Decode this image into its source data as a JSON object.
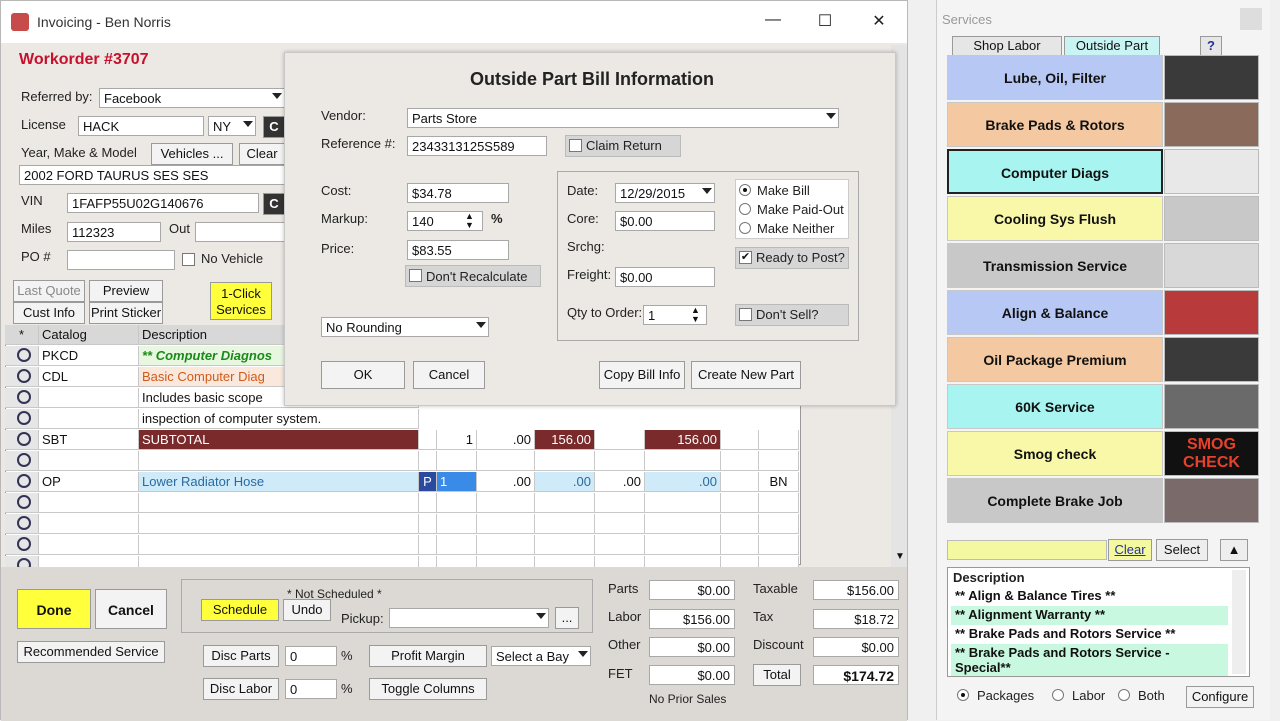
{
  "window": {
    "title": "Invoicing - Ben Norris",
    "minimize": "—",
    "maximize": "☐",
    "close": "✕"
  },
  "workorder": {
    "title": "Workorder #3707"
  },
  "left": {
    "referred_label": "Referred by:",
    "referred_value": "Facebook",
    "license_label": "License",
    "license_value": "HACK",
    "state_value": "NY",
    "ymm_label": "Year, Make & Model",
    "vehicles_btn": "Vehicles ...",
    "clear_btn": "Clear",
    "vehicle_value": "2002 FORD TAURUS SES SES",
    "vin_label": "VIN",
    "vin_value": "1FAFP55U02G140676",
    "miles_label": "Miles",
    "miles_value": "112323",
    "out_label": "Out",
    "po_label": "PO #",
    "no_vehicle": "No Vehicle",
    "last_quote": "Last Quote",
    "preview": "Preview",
    "cust_info": "Cust Info",
    "print_sticker": "Print Sticker",
    "one_click": "1-Click Services",
    "c_btn": "C"
  },
  "grid": {
    "headers": [
      "*",
      "Catalog",
      "Description"
    ],
    "rows": [
      {
        "catalog": "PKCD",
        "desc": "** Computer Diagnos"
      },
      {
        "catalog": "CDL",
        "desc": "Basic Computer Diag"
      },
      {
        "catalog": "",
        "desc": "Includes basic scope"
      },
      {
        "catalog": "",
        "desc": "inspection of computer system."
      },
      {
        "catalog": "SBT",
        "desc": "SUBTOTAL",
        "qty": "1",
        "c1": ".00",
        "c2": "156.00",
        "c4": "156.00"
      },
      {
        "catalog": "",
        "desc": ""
      },
      {
        "catalog": "OP",
        "desc": "Lower Radiator Hose",
        "flag": "P",
        "qty": "1",
        "c1": ".00",
        "c2": ".00",
        "c3": ".00",
        "c4": ".00",
        "tech": "BN"
      }
    ]
  },
  "bottom": {
    "done": "Done",
    "cancel": "Cancel",
    "recommended": "Recommended Service",
    "not_scheduled": "* Not Scheduled *",
    "schedule": "Schedule",
    "undo": "Undo",
    "pickup_label": "Pickup:",
    "ellipsis": "...",
    "disc_parts": "Disc Parts",
    "disc_parts_val": "0",
    "disc_labor": "Disc Labor",
    "disc_labor_val": "0",
    "pct": "%",
    "profit_margin": "Profit Margin",
    "toggle_columns": "Toggle Columns",
    "select_bay": "Select a Bay",
    "parts_label": "Parts",
    "parts_val": "$0.00",
    "labor_label": "Labor",
    "labor_val": "$156.00",
    "other_label": "Other",
    "other_val": "$0.00",
    "fet_label": "FET",
    "fet_val": "$0.00",
    "no_prior": "No Prior Sales",
    "taxable_label": "Taxable",
    "taxable_val": "$156.00",
    "tax_label": "Tax",
    "tax_val": "$18.72",
    "discount_label": "Discount",
    "discount_val": "$0.00",
    "total_btn": "Total",
    "total_val": "$174.72"
  },
  "dialog": {
    "title": "Outside Part Bill Information",
    "vendor_label": "Vendor:",
    "vendor_value": "Parts Store",
    "ref_label": "Reference #:",
    "ref_value": "2343313125S589",
    "claim_return": "Claim Return",
    "cost_label": "Cost:",
    "cost_value": "$34.78",
    "markup_label": "Markup:",
    "markup_value": "140",
    "markup_unit": "%",
    "price_label": "Price:",
    "price_value": "$83.55",
    "dont_recalc": "Don't Recalculate",
    "rounding_value": "No Rounding",
    "date_label": "Date:",
    "date_value": "12/29/2015",
    "core_label": "Core:",
    "core_value": "$0.00",
    "srchg_label": "Srchg:",
    "freight_label": "Freight:",
    "freight_value": "$0.00",
    "qty_label": "Qty to Order:",
    "qty_value": "1",
    "make_bill": "Make Bill",
    "make_paid_out": "Make Paid-Out",
    "make_neither": "Make Neither",
    "ready_to_post": "Ready to Post?",
    "dont_sell": "Don't Sell?",
    "ok": "OK",
    "cancel": "Cancel",
    "copy_bill": "Copy Bill Info",
    "create_new": "Create New Part"
  },
  "services": {
    "title": "Services",
    "tabs": [
      "Shop Labor",
      "Outside Part"
    ],
    "help": "?",
    "items": [
      {
        "label": "Lube, Oil, Filter",
        "color": "#b8c8f4"
      },
      {
        "label": "Brake Pads & Rotors",
        "color": "#f4c8a0"
      },
      {
        "label": "Computer Diags",
        "color": "#a8f4f0"
      },
      {
        "label": "Cooling Sys Flush",
        "color": "#f8f8a8"
      },
      {
        "label": "Transmission Service",
        "color": "#c8c8c8"
      },
      {
        "label": "Align & Balance",
        "color": "#b8c8f4"
      },
      {
        "label": "Oil Package Premium",
        "color": "#f4c8a0"
      },
      {
        "label": "60K Service",
        "color": "#a8f4f0"
      },
      {
        "label": "Smog check",
        "color": "#f8f8a8"
      },
      {
        "label": "Complete Brake Job",
        "color": "#c8c8c8"
      }
    ],
    "smog_text": "SMOG CHECK",
    "clear": "Clear",
    "select": "Select",
    "desc_header": "Description",
    "desc_rows": [
      "** Align & Balance Tires **",
      "** Alignment Warranty **",
      "** Brake Pads and Rotors Service **",
      "** Brake Pads and Rotors Service - Special**"
    ],
    "radio_packages": "Packages",
    "radio_labor": "Labor",
    "radio_both": "Both",
    "configure": "Configure"
  }
}
